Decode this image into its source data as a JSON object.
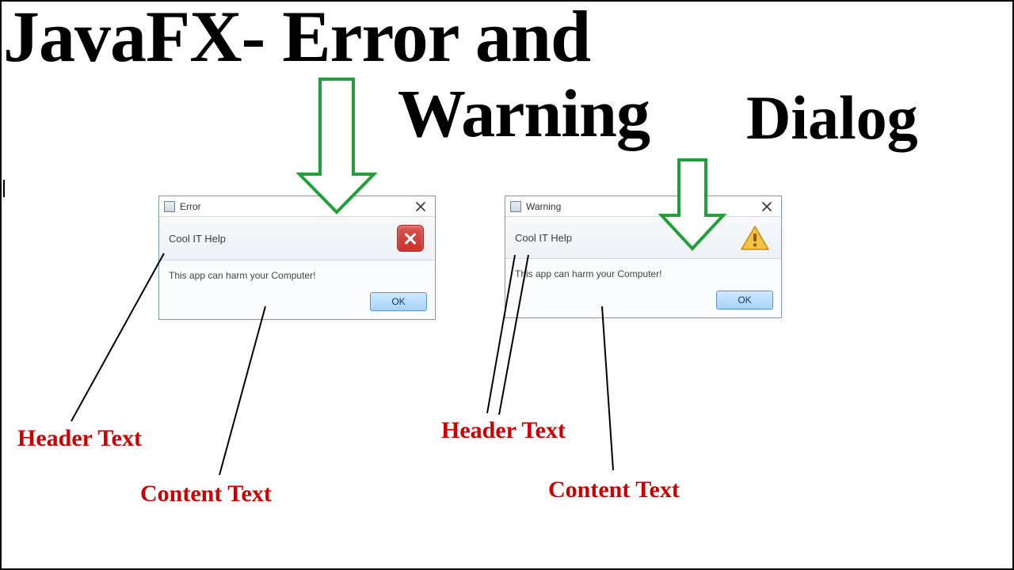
{
  "title": {
    "line1": "JavaFX- Error and",
    "line2": "Warning",
    "line3": "Dialog"
  },
  "dialogs": {
    "error": {
      "title": "Error",
      "header": "Cool IT Help",
      "content": "This app can harm your Computer!",
      "ok": "OK"
    },
    "warning": {
      "title": "Warning",
      "header": "Cool IT Help",
      "content": "This app can harm your Computer!",
      "ok": "OK"
    }
  },
  "annotations": {
    "header_left": "Header Text",
    "content_left": "Content Text",
    "header_right": "Header Text",
    "content_right": "Content Text"
  },
  "colors": {
    "accent_green": "#1fa038",
    "annotation_red": "#cc0000",
    "dialog_border": "#7d99b3",
    "ok_button": "#a8d4fb",
    "error_icon": "#c9302c",
    "warning_icon": "#e6a817"
  }
}
